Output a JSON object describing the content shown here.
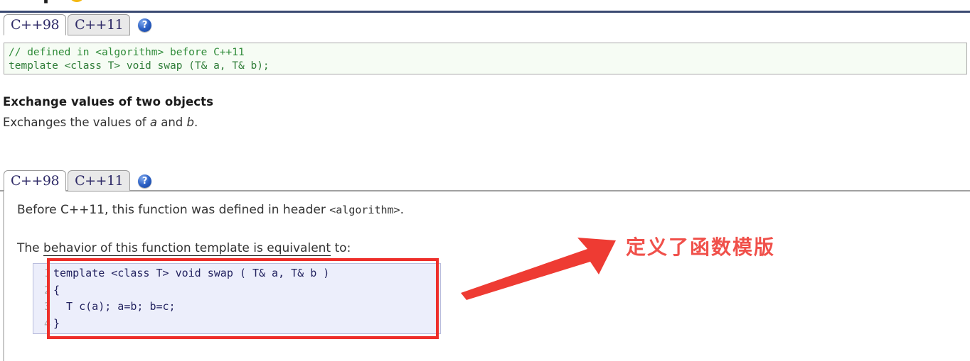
{
  "page": {
    "clipped_title": "swap",
    "title_badge": "function-badge-icon"
  },
  "tabs_top": {
    "items": [
      {
        "label": "C++98",
        "active": true
      },
      {
        "label": "C++11",
        "active": false
      }
    ],
    "help_glyph": "?"
  },
  "code_panel_1": {
    "comment_line": "// defined in <algorithm> before C++11",
    "signature_line": "template <class T> void swap (T& a, T& b);"
  },
  "section": {
    "heading": "Exchange values of two objects",
    "desc_prefix": "Exchanges the values of ",
    "desc_var_a": "a",
    "desc_mid": " and ",
    "desc_var_b": "b",
    "desc_suffix": "."
  },
  "tabs_second": {
    "items": [
      {
        "label": "C++98",
        "active": true
      },
      {
        "label": "C++11",
        "active": false
      }
    ],
    "help_glyph": "?"
  },
  "panel_2": {
    "para_before_prefix": "Before C++11, this function was defined in header ",
    "para_before_header": "<algorithm>",
    "para_before_suffix": ".",
    "para_behavior_prefix": "The ",
    "para_behavior_underlined": "behavior of this function template is equivalent",
    "para_behavior_suffix": " to:",
    "code": {
      "line_numbers": [
        "1",
        "2",
        "3",
        "4"
      ],
      "lines": [
        "template <class T> void swap ( T& a, T& b )",
        "{",
        "  T c(a); a=b; b=c;",
        "}"
      ]
    }
  },
  "annotation": {
    "text": "定义了函数模版",
    "color": "#f0504a",
    "box_color": "#ee2f2a",
    "arrow_name": "red-arrow"
  }
}
